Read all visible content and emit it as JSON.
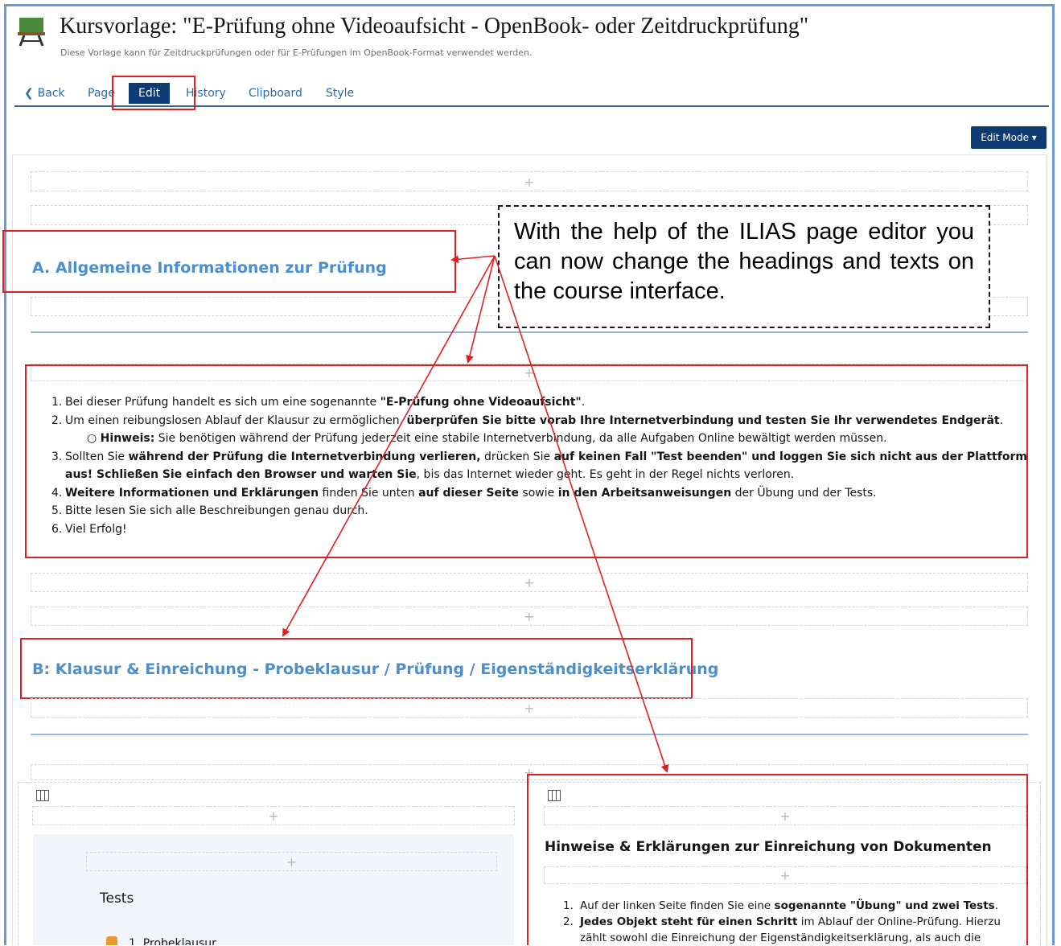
{
  "header": {
    "title": "Kursvorlage: \"E-Prüfung ohne Videoaufsicht - OpenBook- oder Zeitdruckprüfung\"",
    "subtitle": "Diese Vorlage kann für Zeitdruckprüfungen oder für E-Prüfungen im OpenBook-Format verwendet werden.",
    "icon": "course-board-icon"
  },
  "tabs": {
    "back": "Back",
    "page": "Page",
    "edit": "Edit",
    "history": "History",
    "clipboard": "Clipboard",
    "style": "Style"
  },
  "edit_mode_button": "Edit Mode ▾",
  "plus": "+",
  "section_a": {
    "heading": "A. Allgemeine Informationen zur Prüfung",
    "items": {
      "i1_n": "1.",
      "i1_a": "Bei dieser Prüfung handelt es sich um eine sogenannte ",
      "i1_b": "\"E-Prüfung ohne Videoaufsicht\"",
      "i1_c": ".",
      "i2_n": "2.",
      "i2_a": "Um einen reibungslosen Ablauf der Klausur zu ermöglichen, ",
      "i2_b": "überprüfen Sie bitte vorab Ihre Internetverbindung und testen Sie Ihr verwendetes Endgerät",
      "i2_c": ".",
      "i2s_bullet": "○",
      "i2s_b": "Hinweis:",
      "i2s_a": " Sie benötigen während der Prüfung jederzeit eine stabile Internetverbindung, da alle Aufgaben Online bewältigt werden müssen.",
      "i3_n": "3.",
      "i3_a": "Sollten Sie ",
      "i3_b": "während der Prüfung die Internetverbindung verlieren,",
      "i3_c": " drücken Sie ",
      "i3_d": "auf keinen Fall \"Test beenden\" und loggen Sie sich nicht aus der Plattform",
      "i3_e": "aus! Schließen Sie einfach den Browser und warten Sie",
      "i3_f": ", bis das Internet wieder geht. Es geht in der Regel nichts verloren.",
      "i4_n": "4.",
      "i4_b": "Weitere Informationen und Erklärungen",
      "i4_a": " finden Sie unten ",
      "i4_c": "auf dieser Seite",
      "i4_d": " sowie ",
      "i4_e": "in den Arbeitsanweisungen",
      "i4_f": " der Übung und der Tests.",
      "i5_n": "5.",
      "i5_a": "Bitte lesen Sie sich alle Beschreibungen genau durch.",
      "i6_n": "6.",
      "i6_a": "Viel Erfolg!"
    }
  },
  "section_b": {
    "heading": "B: Klausur & Einreichung - Probeklausur / Prüfung / Eigenständigkeitserklärung"
  },
  "left_panel": {
    "tests_label": "Tests",
    "item_partial": "1. Probeklausur"
  },
  "right_panel": {
    "heading": "Hinweise & Erklärungen zur Einreichung von Dokumenten",
    "r1_n": "1.",
    "r1_a": "Auf der linken Seite finden Sie eine ",
    "r1_b": "sogenannte \"Übung\" und zwei Tests",
    "r1_c": ".",
    "r2_n": "2.",
    "r2_b": "Jedes Objekt steht für einen Schritt",
    "r2_a": " im Ablauf der Online-Prüfung. Hierzu",
    "r2_cont": "zählt sowohl die Einreichung der Eigenständigkeitserklärung, als auch die"
  },
  "callout": {
    "text": "With the help of the ILIAS page editor you can now change the headings and texts on the course interface."
  },
  "colors": {
    "tab_active_bg": "#0d3a73",
    "link": "#2a6ab3",
    "heading": "#4c8fd0",
    "annotation_red": "#e02020",
    "frame_blue": "#6b9bd6"
  }
}
